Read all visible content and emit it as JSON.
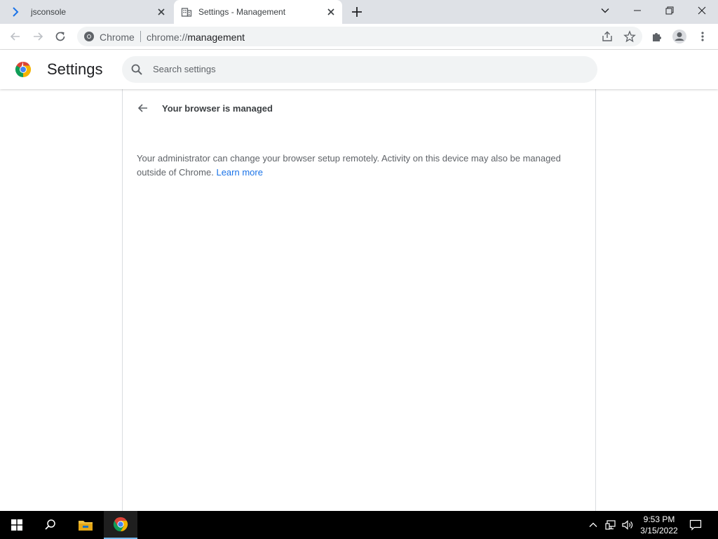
{
  "tabs": [
    {
      "title": "jsconsole",
      "icon": "terminal-prompt-icon",
      "active": false
    },
    {
      "title": "Settings - Management",
      "icon": "building-icon",
      "active": true
    }
  ],
  "toolbar": {
    "site_name": "Chrome",
    "url_scheme": "chrome://",
    "url_path": "management"
  },
  "settings": {
    "title": "Settings",
    "search_placeholder": "Search settings"
  },
  "management": {
    "heading": "Your browser is managed",
    "description": "Your administrator can change your browser setup remotely. Activity on this device may also be managed outside of Chrome.",
    "learn_more": "Learn more"
  },
  "taskbar": {
    "time": "9:53 PM",
    "date": "3/15/2022"
  },
  "colors": {
    "accent": "#1a73e8",
    "tabstrip": "#dee1e6",
    "taskbar": "#000000"
  }
}
